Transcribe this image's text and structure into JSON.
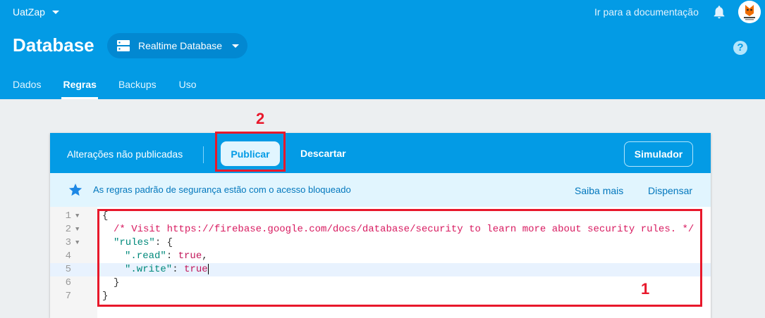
{
  "header": {
    "project_name": "UatZap",
    "docs_link": "Ir para a documentação",
    "page_title": "Database",
    "db_selector": "Realtime Database",
    "help_label": "?",
    "tabs": [
      {
        "label": "Dados"
      },
      {
        "label": "Regras"
      },
      {
        "label": "Backups"
      },
      {
        "label": "Uso"
      }
    ],
    "active_tab": "Regras",
    "brand_color": "#039be5"
  },
  "toolbar": {
    "status": "Alterações não publicadas",
    "publish_label": "Publicar",
    "discard_label": "Descartar",
    "simulator_label": "Simulador"
  },
  "banner": {
    "message": "As regras padrão de segurança estão com o acesso bloqueado",
    "learn_more": "Saiba mais",
    "dismiss": "Dispensar"
  },
  "editor": {
    "line_numbers": [
      "1",
      "2",
      "3",
      "4",
      "5",
      "6",
      "7"
    ],
    "lines": {
      "l1": "{",
      "l2": "/* Visit https://firebase.google.com/docs/database/security to learn more about security rules. */",
      "l3_key": "\"rules\"",
      "l3_rest": ": {",
      "l4_key": "\".read\"",
      "l4_sep": ": ",
      "l4_val": "true",
      "l4_end": ",",
      "l5_key": "\".write\"",
      "l5_sep": ": ",
      "l5_val": "true",
      "l6": "}",
      "l7": "}"
    }
  },
  "annotations": {
    "label_1": "1",
    "label_2": "2",
    "color": "#e8182b"
  }
}
